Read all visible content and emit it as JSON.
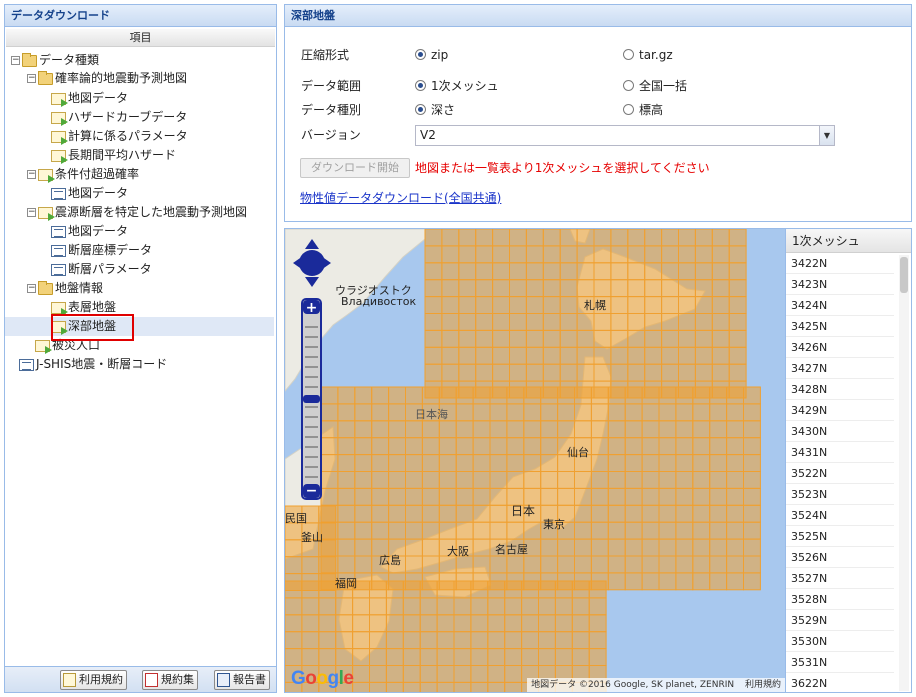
{
  "left_panel": {
    "title": "データダウンロード",
    "column_header": "項目",
    "tree": [
      {
        "label": "データ種類",
        "expander": "⊟",
        "icon": "folder-icon"
      },
      {
        "label": "確率論的地震動予測地図",
        "expander": "⊟",
        "icon": "folder-icon"
      },
      {
        "label": "地図データ",
        "icon": "data-leaf-icon"
      },
      {
        "label": "ハザードカーブデータ",
        "icon": "data-leaf-icon"
      },
      {
        "label": "計算に係るパラメータ",
        "icon": "data-leaf-icon"
      },
      {
        "label": "長期間平均ハザード",
        "icon": "data-leaf-icon"
      },
      {
        "label": "条件付超過確率",
        "expander": "⊟",
        "icon": "data-leaf-icon"
      },
      {
        "label": "地図データ",
        "icon": "table-icon"
      },
      {
        "label": "震源断層を特定した地震動予測地図",
        "expander": "⊟",
        "icon": "data-leaf-icon"
      },
      {
        "label": "地図データ",
        "icon": "table-icon"
      },
      {
        "label": "断層座標データ",
        "icon": "table-icon"
      },
      {
        "label": "断層パラメータ",
        "icon": "table-icon"
      },
      {
        "label": "地盤情報",
        "expander": "⊟",
        "icon": "folder-icon"
      },
      {
        "label": "表層地盤",
        "icon": "data-leaf-icon"
      },
      {
        "label": "深部地盤",
        "icon": "data-leaf-icon",
        "selected": true
      },
      {
        "label": "被災人口",
        "icon": "data-leaf-icon"
      },
      {
        "label": "J-SHIS地震・断層コード",
        "icon": "table-icon"
      }
    ],
    "buttons": {
      "terms": "利用規約",
      "terms_collection": "規約集",
      "report": "報告書"
    }
  },
  "form": {
    "title": "深部地盤",
    "compression_label": "圧縮形式",
    "compression_zip": "zip",
    "compression_targz": "tar.gz",
    "range_label": "データ範囲",
    "range_mesh": "1次メッシュ",
    "range_all": "全国一括",
    "type_label": "データ種別",
    "type_depth": "深さ",
    "type_elevation": "標高",
    "version_label": "バージョン",
    "version_value": "V2",
    "download_button": "ダウンロード開始",
    "error_message": "地図または一覧表より1次メッシュを選択してください",
    "property_link": "物性値データダウンロード(全国共通)",
    "colors": {
      "error": "#e60000",
      "link": "#1a34c9"
    }
  },
  "map": {
    "labels": {
      "vladivostok_ja": "ウラジオストク",
      "vladivostok_ru": "Владивосток",
      "sapporo": "札幌",
      "sea_of_japan": "日本海",
      "sendai": "仙台",
      "japan": "日本",
      "tokyo": "東京",
      "nagoya": "名古屋",
      "osaka": "大阪",
      "hiroshima": "広島",
      "fukuoka": "福岡",
      "busan": "釜山",
      "korea_partial": "民国"
    },
    "copyright": "地図データ ©2016 Google, SK planet, ZENRIN",
    "terms_link": "利用規約",
    "google_logo": "Google",
    "colors": {
      "mesh": "#f0a030",
      "sea": "#a8c8ee",
      "land": "#ecebe4"
    }
  },
  "mesh_list": {
    "header": "1次メッシュ",
    "items": [
      "3422N",
      "3423N",
      "3424N",
      "3425N",
      "3426N",
      "3427N",
      "3428N",
      "3429N",
      "3430N",
      "3431N",
      "3522N",
      "3523N",
      "3524N",
      "3525N",
      "3526N",
      "3527N",
      "3528N",
      "3529N",
      "3530N",
      "3531N",
      "3622N"
    ]
  }
}
